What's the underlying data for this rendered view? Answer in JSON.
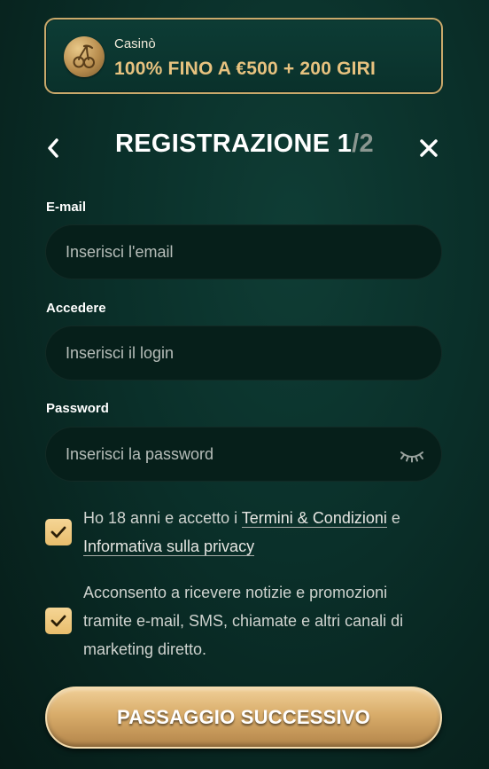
{
  "bonus": {
    "category": "Casinò",
    "offer": "100% FINO A €500 + 200 GIRI",
    "icon": "cherry-icon"
  },
  "header": {
    "title": "REGISTRAZIONE 1",
    "title_sep": "/",
    "title_total": "2",
    "back_icon": "chevron-left-icon",
    "close_icon": "close-icon"
  },
  "form": {
    "email": {
      "label": "E-mail",
      "placeholder": "Inserisci l'email",
      "value": ""
    },
    "login": {
      "label": "Accedere",
      "placeholder": "Inserisci il login",
      "value": ""
    },
    "password": {
      "label": "Password",
      "placeholder": "Inserisci la password",
      "value": "",
      "toggle_icon": "eye-closed-icon"
    }
  },
  "consents": {
    "terms": {
      "checked": true,
      "text_before": "Ho 18 anni e accetto i ",
      "link_terms": "Termini & Condizioni",
      "text_middle": " e ",
      "link_privacy": "Informativa sulla privacy"
    },
    "marketing": {
      "checked": true,
      "text": "Acconsento a ricevere notizie e promozioni tramite e-mail, SMS, chiamate e altri canali di marketing diretto."
    }
  },
  "actions": {
    "next_label": "PASSAGGIO SUCCESSIVO"
  },
  "colors": {
    "accent_gold": "#e7c27f",
    "background": "#0a2f29",
    "input_bg": "#061f1a"
  }
}
